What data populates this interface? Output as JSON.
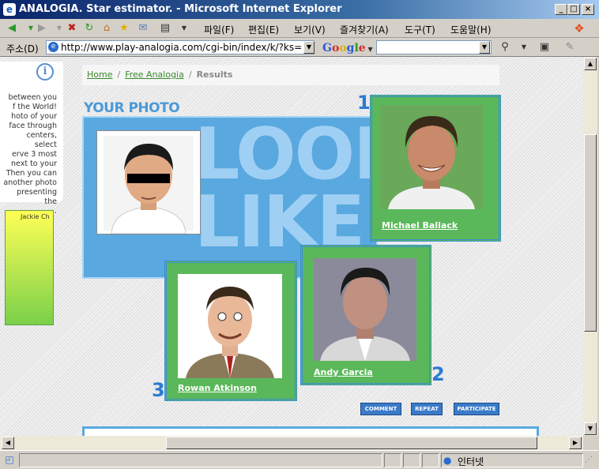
{
  "window": {
    "title": "ANALOGIA. Star estimator. - Microsoft Internet Explorer",
    "minimize": "_",
    "maximize": "□",
    "close": "×"
  },
  "menu": [
    "파일(F)",
    "편집(E)",
    "보기(V)",
    "즐겨찾기(A)",
    "도구(T)",
    "도움말(H)"
  ],
  "address": {
    "label": "주소(D)",
    "url": "http://www.play-analogia.com/cgi-bin/index/k/?ks="
  },
  "google": {
    "brand": "Google"
  },
  "sidebar": {
    "text": "between you\nf the World!\nhoto of your\nface through\ncenters, select\nerve 3 most\nnext to your\nThen you can\nanother photo\npresenting the\n.",
    "green_label": "Jackie Ch"
  },
  "breadcrumb": {
    "home": "Home",
    "free": "Free Analogia",
    "current": "Results",
    "separator": "/"
  },
  "page": {
    "your_photo": "YOUR PHOTO",
    "look_like": "LOOK\nLIKE"
  },
  "matches": [
    {
      "rank": "1",
      "name": "Michael Ballack"
    },
    {
      "rank": "2",
      "name": "Andy Garcia"
    },
    {
      "rank": "3",
      "name": "Rowan Atkinson"
    }
  ],
  "actions": {
    "comment": "COMMENT",
    "repeat": "REPEAT",
    "participate": "PARTICIPATE"
  },
  "status": {
    "zone": "인터넷"
  },
  "colors": {
    "accent_blue": "#5aa8e0",
    "frame_green": "#5ab85a",
    "link_green": "#3a8a2a"
  }
}
